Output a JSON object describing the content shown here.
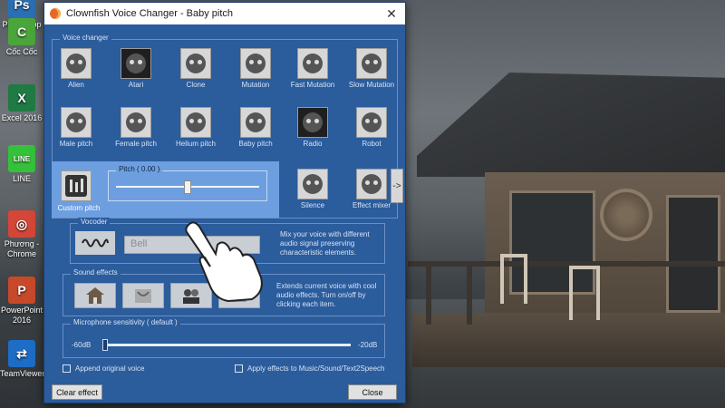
{
  "desktop": {
    "icons": [
      {
        "label": "Photoshop",
        "icon": "photoshop-icon",
        "color": "#2a6fb3",
        "glyph": "Ps"
      },
      {
        "label": "Cốc Cốc",
        "icon": "coccoc-browser-icon",
        "color": "#4aa63b",
        "glyph": "C"
      },
      {
        "label": "Excel 2016",
        "icon": "excel-icon",
        "color": "#1f7a44",
        "glyph": "X"
      },
      {
        "label": "LINE",
        "icon": "line-app-icon",
        "color": "#35c13a",
        "glyph": "LINE"
      },
      {
        "label": "Phương - Chrome",
        "icon": "chrome-icon",
        "color": "#d44637",
        "glyph": "◎"
      },
      {
        "label": "PowerPoint 2016",
        "icon": "powerpoint-icon",
        "color": "#c8492a",
        "glyph": "P"
      },
      {
        "label": "TeamViewer",
        "icon": "teamviewer-icon",
        "color": "#1d6cc6",
        "glyph": "⇄"
      }
    ]
  },
  "window": {
    "title": "Clownfish Voice Changer - Baby pitch",
    "close_glyph": "✕"
  },
  "voice_changer": {
    "label": "Voice changer",
    "row1": [
      {
        "label": "Alien",
        "icon": "alien-icon"
      },
      {
        "label": "Atari",
        "icon": "atari-icon"
      },
      {
        "label": "Clone",
        "icon": "clone-icon"
      },
      {
        "label": "Mutation",
        "icon": "mutation-icon"
      },
      {
        "label": "Fast Mutation",
        "icon": "fast-mutation-icon"
      },
      {
        "label": "Slow Mutation",
        "icon": "slow-mutation-icon"
      }
    ],
    "row2": [
      {
        "label": "Male pitch",
        "icon": "male-pitch-icon"
      },
      {
        "label": "Female pitch",
        "icon": "female-pitch-icon"
      },
      {
        "label": "Helium pitch",
        "icon": "helium-pitch-icon"
      },
      {
        "label": "Baby pitch",
        "icon": "baby-pitch-icon"
      },
      {
        "label": "Radio",
        "icon": "radio-icon"
      },
      {
        "label": "Robot",
        "icon": "robot-icon"
      }
    ],
    "custom_pitch": {
      "label": "Custom pitch",
      "pitch_label": "Pitch ( 0.00 )",
      "pitch_value": 0.0
    },
    "row3_rest": [
      {
        "label": "Silence",
        "icon": "silence-icon"
      },
      {
        "label": "Effect mixer",
        "icon": "effect-mixer-icon"
      }
    ],
    "more_arrow": "->"
  },
  "vocoder": {
    "label": "Vocoder",
    "selected": "Bell",
    "description": "Mix your voice with different audio signal preserving characteristic elements."
  },
  "sound_effects": {
    "label": "Sound effects",
    "description": "Extends current voice with cool audio effects. Turn on/off by clicking each item."
  },
  "microphone": {
    "label": "Microphone sensitivity ( default )",
    "min_label": "-60dB",
    "max_label": "-20dB"
  },
  "options": {
    "append_original": "Append original voice",
    "apply_effects": "Apply effects to Music/Sound/Text2Speech"
  },
  "buttons": {
    "clear": "Clear effect",
    "close": "Close"
  },
  "colors": {
    "window_bg": "#2b5c9c",
    "selection": "#6d9fe0",
    "group_border": "#6b90c7"
  }
}
